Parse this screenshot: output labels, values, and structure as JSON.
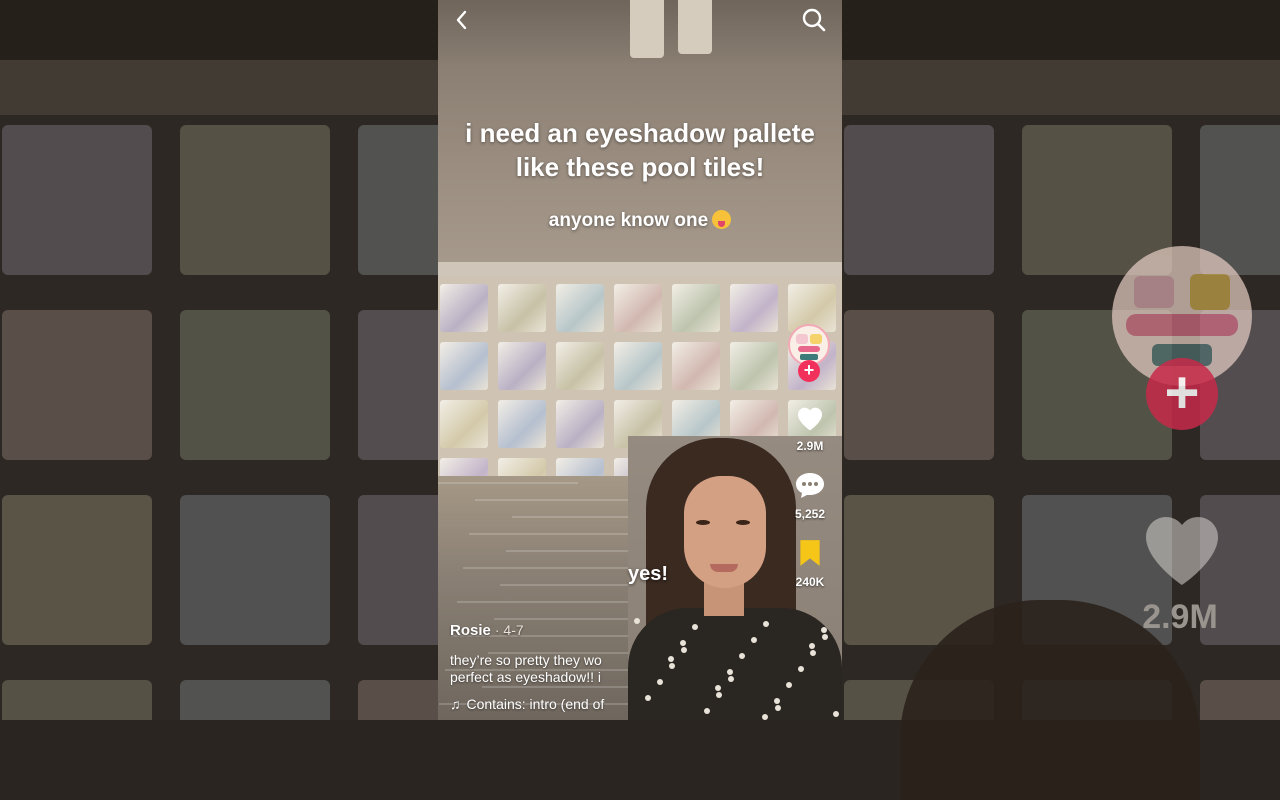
{
  "nav": {
    "back_icon": "chevron-left-icon",
    "search_icon": "search-icon"
  },
  "video": {
    "caption_main_line1": "i need an eyeshadow pallete",
    "caption_main_line2": "like these pool tiles!",
    "caption_sub": "anyone know one",
    "reply_text": "yes!"
  },
  "actions": {
    "follow_label": "+",
    "likes": "2.9M",
    "comments": "5,252",
    "saves": "240K"
  },
  "meta": {
    "username": "Rosie",
    "date": "· 4-7",
    "description": "they're so pretty they wo... perfect as eyeshadow!! i...",
    "description_line1": "they’re so pretty they wo",
    "description_line2": "perfect as eyeshadow!! i",
    "sound": "Contains: intro (end of"
  },
  "background": {
    "enlarged_likes": "2.9M",
    "enlarged_follow_label": "+"
  },
  "colors": {
    "follow_red": "#f2305c",
    "save_yellow": "#f5c518",
    "caption_white": "#ffffff"
  }
}
